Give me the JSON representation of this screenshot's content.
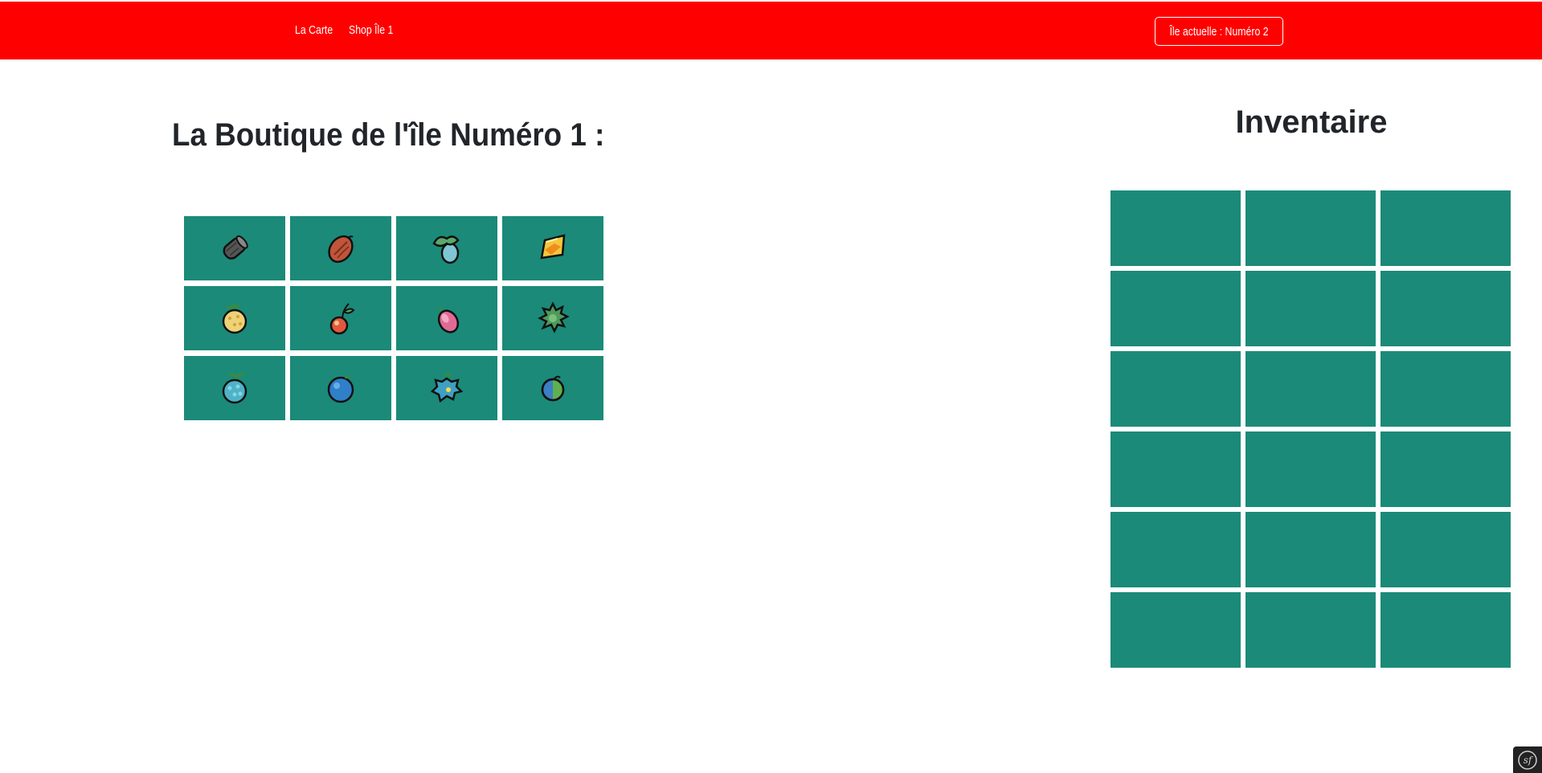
{
  "navbar": {
    "links": [
      {
        "label": "La Carte"
      },
      {
        "label": "Shop Île 1"
      }
    ],
    "current_island": "Île actuelle : Numéro 2",
    "bg_color": "#ff0000"
  },
  "shop": {
    "title": "La Boutique de l'île Numéro 1 :",
    "cell_color": "#1b8a79",
    "items": [
      {
        "icon": "charcoal-log-icon"
      },
      {
        "icon": "brown-seed-icon"
      },
      {
        "icon": "blue-berry-with-leaves-icon"
      },
      {
        "icon": "yellow-shard-icon"
      },
      {
        "icon": "yellow-bumpy-berry-icon"
      },
      {
        "icon": "red-cherry-berry-icon"
      },
      {
        "icon": "pink-berry-icon"
      },
      {
        "icon": "green-spiky-berry-icon"
      },
      {
        "icon": "teal-bumpy-berry-icon"
      },
      {
        "icon": "blue-berry-icon"
      },
      {
        "icon": "blue-spiky-berry-icon"
      },
      {
        "icon": "blue-green-berry-icon"
      }
    ]
  },
  "inventory": {
    "title": "Inventaire",
    "slots": 18,
    "cell_color": "#1b8a79"
  },
  "debug_toolbar": {
    "icon": "symfony-sf-icon"
  }
}
